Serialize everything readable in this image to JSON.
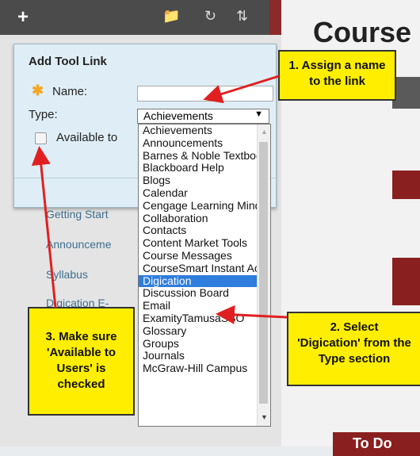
{
  "toolbar": {
    "add": "+",
    "icons": [
      "folder-icon",
      "refresh-icon",
      "sort-icon"
    ]
  },
  "page": {
    "course_title": "Course",
    "todo": "To Do"
  },
  "menu": [
    "Getting Start",
    "Announceme",
    "Syllabus",
    "Digication E-"
  ],
  "dialog": {
    "title": "Add Tool Link",
    "name_label": "Name:",
    "type_label": "Type:",
    "available_label": "Available to",
    "selected_type": "Achievements"
  },
  "types": [
    "Achievements",
    "Announcements",
    "Barnes & Noble Textbook Tool",
    "Blackboard Help",
    "Blogs",
    "Calendar",
    "Cengage Learning MindLinks™ Tools",
    "Collaboration",
    "Contacts",
    "Content Market Tools",
    "Course Messages",
    "CourseSmart Instant Access Tool",
    "Digication",
    "Discussion Board",
    "Email",
    "ExamityTamusaSSO",
    "Glossary",
    "Groups",
    "Journals",
    "McGraw-Hill Campus"
  ],
  "highlighted_type": "Digication",
  "callouts": {
    "c1": [
      "1. Assign a name",
      "to the link"
    ],
    "c2": [
      "2. Select",
      "'Digication' from the",
      "Type section"
    ],
    "c3": [
      "3. Make sure",
      "'Available to",
      "Users' is",
      "checked"
    ]
  },
  "colors": {
    "callout": "#ffee00",
    "arrow": "#e02020",
    "highlight": "#2f7ddd",
    "dialog_bg": "#dfeef6"
  }
}
